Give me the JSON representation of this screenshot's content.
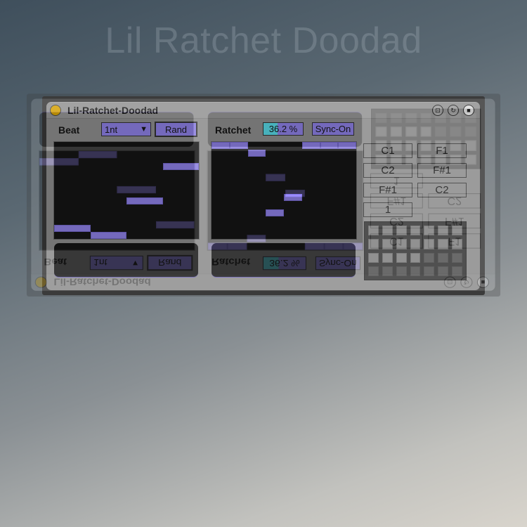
{
  "background_title": "Lil Ratchet Doodad",
  "device": {
    "title": "Lil-Ratchet-Doodad",
    "power_color": "#f5b800",
    "header_icons": [
      "hotswap-icon",
      "map-icon",
      "save-icon"
    ],
    "accent_color": "#9b8cff",
    "slider_fill_color": "#5ef0ff"
  },
  "beat": {
    "label": "Beat",
    "division": {
      "selected": "1nt"
    },
    "rand_label": "Rand",
    "editor": {
      "steps": 4,
      "levels": 14,
      "values": [
        2,
        1,
        6,
        11
      ]
    }
  },
  "ratchet": {
    "label": "Ratchet",
    "amount_text": "36.2 %",
    "amount_fraction": 0.362,
    "sync_label": "Sync-On",
    "editor": {
      "steps": 8,
      "levels": 13,
      "values": [
        13,
        13,
        12,
        4,
        6,
        13,
        13,
        13
      ]
    }
  },
  "notes": {
    "buttons": [
      "C1",
      "F1",
      "C2",
      "F#1",
      "F#1",
      "C2"
    ],
    "count": "1"
  },
  "pad_grid": {
    "columns": 7,
    "rows": 4,
    "states": [
      [
        1,
        1,
        1,
        1,
        1,
        1,
        1
      ],
      [
        1,
        1,
        1,
        1,
        1,
        1,
        1
      ],
      [
        1,
        1,
        1,
        1,
        0,
        0,
        0
      ],
      [
        0,
        0,
        0,
        0,
        0,
        0,
        0
      ]
    ]
  }
}
